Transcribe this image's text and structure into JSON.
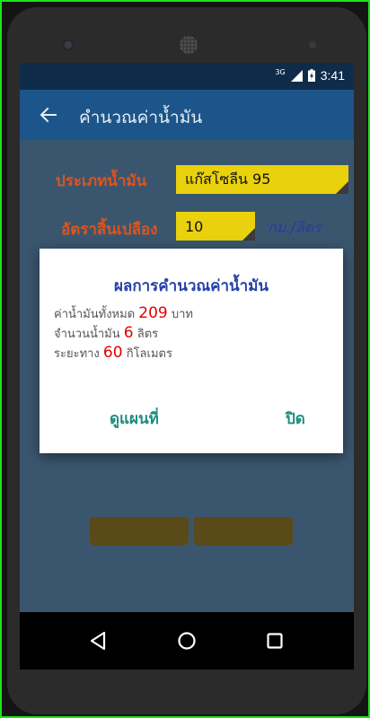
{
  "status_bar": {
    "network": "3G",
    "time": "3:41"
  },
  "app_bar": {
    "title": "คำนวณค่าน้ำมัน",
    "back_icon": "arrow-left-icon"
  },
  "form": {
    "fuel_type_label": "ประเภทน้ำมัน",
    "fuel_type_value": "แก๊สโซลีน 95",
    "rate_label": "อัตราสิ้นเปลือง",
    "rate_value": "10",
    "rate_unit": "กม./ลิตร"
  },
  "dialog": {
    "title": "ผลการคำนวณค่าน้ำมัน",
    "total_cost_prefix": "ค่าน้ำมันทั้งหมด",
    "total_cost_value": "209",
    "total_cost_unit": "บาท",
    "liters_prefix": "จำนวนน้ำมัน",
    "liters_value": "6",
    "liters_unit": "ลิตร",
    "distance_prefix": "ระยะทาง",
    "distance_value": "60",
    "distance_unit": "กิโลเมตร",
    "map_button": "ดูแผนที่",
    "close_button": "ปิด"
  },
  "colors": {
    "status_bar": "#0f2b4a",
    "app_bar": "#1c5589",
    "background": "#3a566f",
    "label_orange": "#e0531b",
    "field_yellow": "#ead10d",
    "dialog_title": "#2540a8",
    "highlight_red": "#e30000",
    "dialog_button": "#1e8c7e"
  },
  "nav_bar": {
    "icons": [
      "back-triangle-icon",
      "home-circle-icon",
      "recents-square-icon"
    ]
  }
}
